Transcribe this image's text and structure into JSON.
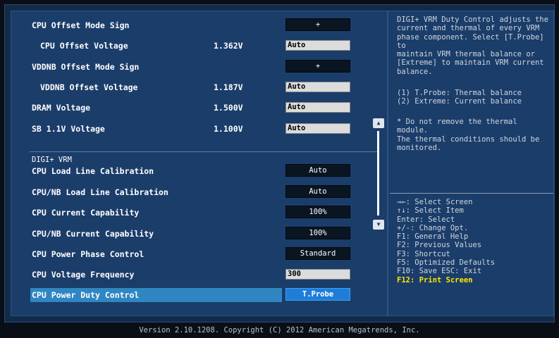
{
  "settings": [
    {
      "label": "CPU Offset Mode Sign",
      "value": "",
      "control": "button",
      "control_value": "+"
    },
    {
      "label": "CPU Offset Voltage",
      "value": "1.362V",
      "control": "input",
      "control_value": "Auto"
    },
    {
      "label": "VDDNB Offset Mode Sign",
      "value": "",
      "control": "button",
      "control_value": "+"
    },
    {
      "label": "VDDNB Offset Voltage",
      "value": "1.187V",
      "control": "input",
      "control_value": "Auto"
    },
    {
      "label": "DRAM Voltage",
      "value": "1.500V",
      "control": "input",
      "control_value": "Auto"
    },
    {
      "label": "SB 1.1V Voltage",
      "value": "1.100V",
      "control": "input",
      "control_value": "Auto"
    }
  ],
  "section_title": "DIGI+ VRM",
  "vrm_settings": [
    {
      "label": "CPU Load Line Calibration",
      "control": "button",
      "control_value": "Auto"
    },
    {
      "label": "CPU/NB Load Line Calibration",
      "control": "button",
      "control_value": "Auto"
    },
    {
      "label": "CPU Current Capability",
      "control": "button",
      "control_value": "100%"
    },
    {
      "label": "CPU/NB Current Capability",
      "control": "button",
      "control_value": "100%"
    },
    {
      "label": "CPU Power Phase Control",
      "control": "button",
      "control_value": "Standard"
    },
    {
      "label": "CPU Voltage Frequency",
      "control": "input",
      "control_value": "300"
    },
    {
      "label": "CPU Power Duty Control",
      "control": "button",
      "control_value": "T.Probe"
    }
  ],
  "help": {
    "description": "DIGI+ VRM Duty Control adjusts the\ncurrent and thermal of every VRM\nphase component. Select [T.Probe] to\nmaintain VRM thermal balance or\n[Extreme] to maintain VRM current\nbalance.",
    "options": "(1) T.Probe: Thermal balance\n(2) Extreme: Current balance",
    "note": "* Do not remove the thermal module.\nThe thermal conditions should be\nmonitored."
  },
  "keys": [
    "→←: Select Screen",
    "↑↓: Select Item",
    "Enter: Select",
    "+/-: Change Opt.",
    "F1: General Help",
    "F2: Previous Values",
    "F3: Shortcut",
    "F5: Optimized Defaults",
    "F10: Save  ESC: Exit",
    "F12: Print Screen"
  ],
  "footer": "Version 2.10.1208. Copyright (C) 2012 American Megatrends, Inc.",
  "colors": {
    "accent": "#2f86c2",
    "highlight_key": "#ffe600",
    "panel": "#1b3d6a"
  }
}
